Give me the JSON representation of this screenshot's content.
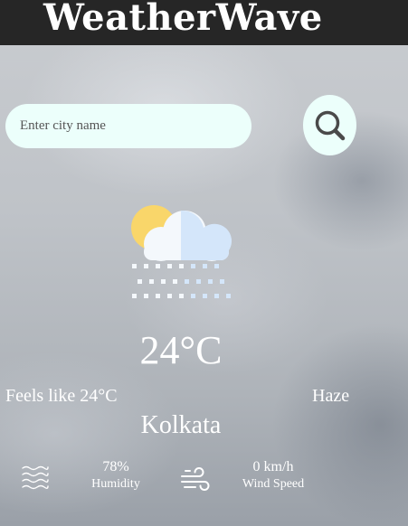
{
  "app": {
    "title": "WeatherWave"
  },
  "search": {
    "placeholder": "Enter city name",
    "value": "",
    "button_icon": "search-icon"
  },
  "weather": {
    "icon": "sun-cloud-snow-icon",
    "temperature": "24°C",
    "feels_like": "Feels like 24°C",
    "condition": "Haze",
    "city": "Kolkata"
  },
  "stats": {
    "humidity": {
      "icon": "humidity-waves-icon",
      "value": "78%",
      "label": "Humidity"
    },
    "wind": {
      "icon": "wind-icon",
      "value": "0 km/h",
      "label": "Wind Speed"
    }
  },
  "colors": {
    "header_bg": "#262626",
    "input_bg": "#ecfffb",
    "sun": "#f9d66a",
    "cloud_light": "#f4f8fc",
    "cloud_blue": "#d4e6fa",
    "text": "#ffffff"
  }
}
